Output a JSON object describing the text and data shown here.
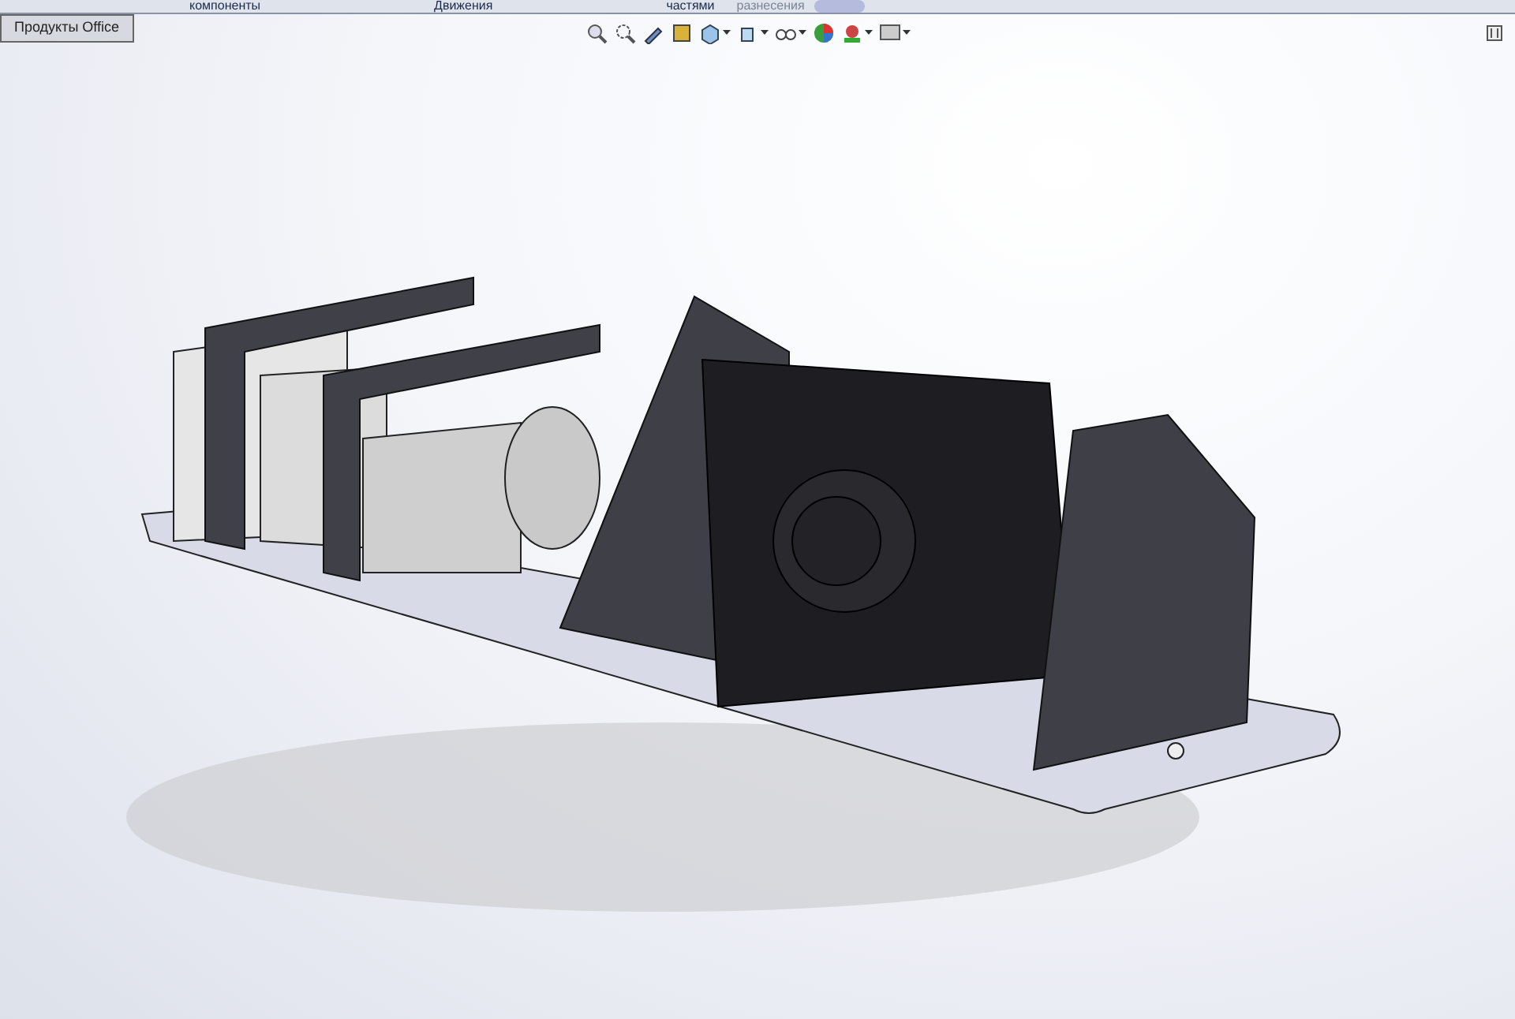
{
  "ribbon": {
    "labels": [
      {
        "text": "компоненты",
        "disabled": false
      },
      {
        "text": "Движения",
        "disabled": false
      },
      {
        "text": "частями",
        "disabled": false
      },
      {
        "text": "разнесения",
        "disabled": true
      }
    ]
  },
  "tabs": [
    {
      "label": "Продукты Office",
      "selected": true
    }
  ]
}
